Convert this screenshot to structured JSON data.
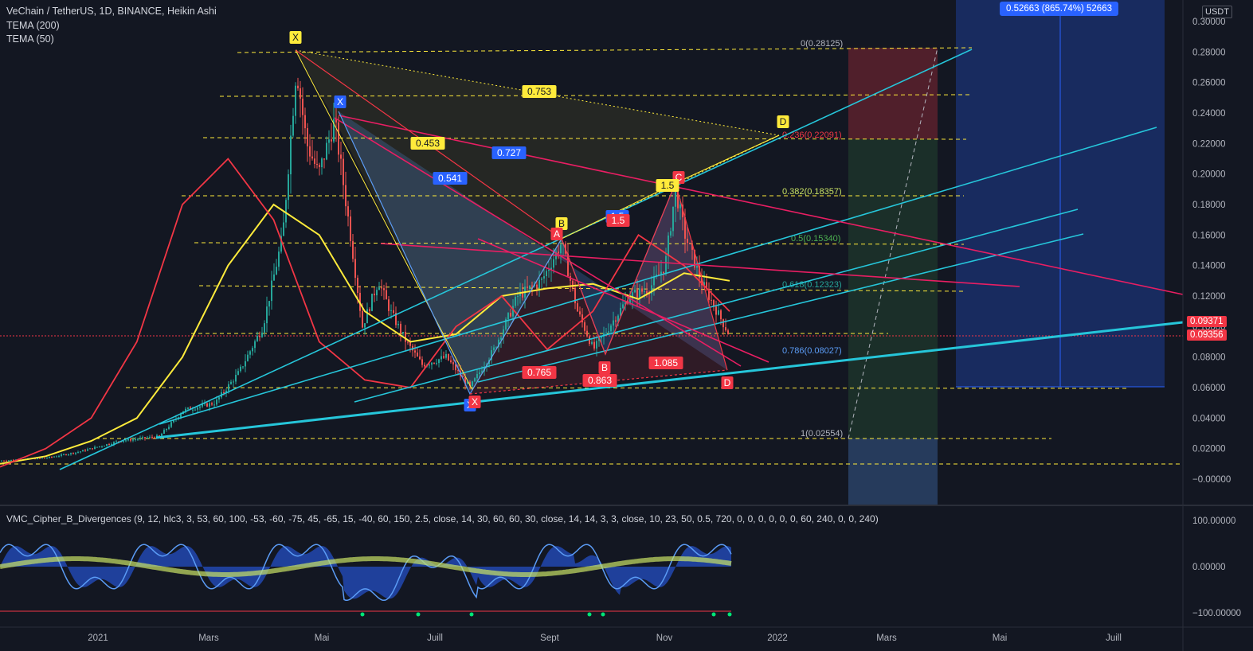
{
  "header": {
    "title": "VeChain / TetherUS, 1D, BINANCE, Heikin Ashi",
    "indicator1": "TEMA (200)",
    "indicator2": "TEMA (50)",
    "currency": "USDT",
    "measure_label": "0.52663 (865.74%) 52663"
  },
  "oscillator": {
    "title": "VMC_Cipher_B_Divergences (9, 12, hlc3, 3, 53, 60, 100, -53, -60, -75, 45, -65, 15, -40, 60, 150, 2.5, close, 14, 30, 60, 60, 30, close, 14, 14, 3, 3, close, 10, 23, 50, 0.5, 720, 0, 0, 0, 0, 0, 0, 60, 240, 0, 0, 240)",
    "ticks": [
      "100.00000",
      "0.00000",
      "−100.00000"
    ]
  },
  "price_tags": [
    "0.09371",
    "0.09356"
  ],
  "fib_levels": [
    {
      "label": "0(0.28125)",
      "color": "#b2b5be"
    },
    {
      "label": "0.236(0.22091)",
      "color": "#f23645"
    },
    {
      "label": "0.382(0.18357)",
      "color": "#c9e265"
    },
    {
      "label": "0.5(0.15340)",
      "color": "#4caf50"
    },
    {
      "label": "0.618(0.12323)",
      "color": "#26a69a"
    },
    {
      "label": "0.786(0.08027)",
      "color": "#5b9cf6"
    },
    {
      "label": "1(0.02554)",
      "color": "#b2b5be"
    }
  ],
  "pattern_labels": {
    "x_yellow": "X",
    "d_yellow": "D",
    "b_yellow": "B",
    "x_blue_top": "X",
    "x_blue_bottom": "X",
    "a_red": "A",
    "b_red": "B",
    "c_red": "C",
    "d_red": "D",
    "x_red": "X",
    "r0753": "0.753",
    "r0453": "0.453",
    "r0727": "0.727",
    "r0541": "0.541",
    "r15a": "1.5",
    "r15b": "1.5",
    "r15c": "1.5",
    "r0765": "0.765",
    "r0863": "0.863",
    "r1085": "1.085"
  },
  "colors": {
    "background": "#131722",
    "tema200": "#ffeb3b",
    "tema50": "#f23645",
    "trendline": "#26c6da",
    "pink": "#e91e63",
    "dashed": "#ffeb3b"
  },
  "chart_data": {
    "type": "candlestick",
    "title": "VeChain / TetherUS, 1D, BINANCE, Heikin Ashi",
    "y_ticks": [
      "0.30000",
      "0.28000",
      "0.26000",
      "0.24000",
      "0.22000",
      "0.20000",
      "0.18000",
      "0.16000",
      "0.14000",
      "0.12000",
      "0.10000",
      "0.08000",
      "0.06000",
      "0.04000",
      "0.02000",
      "−0.00000"
    ],
    "x_ticks": [
      "2021",
      "Mars",
      "Mai",
      "Juill",
      "Sept",
      "Nov",
      "2022",
      "Mars",
      "Mai",
      "Juill"
    ],
    "ylim": [
      -0.005,
      0.305
    ],
    "last_close": 0.09356,
    "series": [
      {
        "name": "TEMA (200)",
        "values": [
          0.01,
          0.015,
          0.025,
          0.04,
          0.08,
          0.14,
          0.18,
          0.16,
          0.11,
          0.09,
          0.095,
          0.12,
          0.125,
          0.128,
          0.118,
          0.135,
          0.13
        ]
      },
      {
        "name": "TEMA (50)",
        "values": [
          0.008,
          0.02,
          0.04,
          0.09,
          0.18,
          0.21,
          0.17,
          0.09,
          0.065,
          0.06,
          0.1,
          0.12,
          0.085,
          0.11,
          0.16,
          0.14,
          0.11
        ]
      }
    ]
  }
}
